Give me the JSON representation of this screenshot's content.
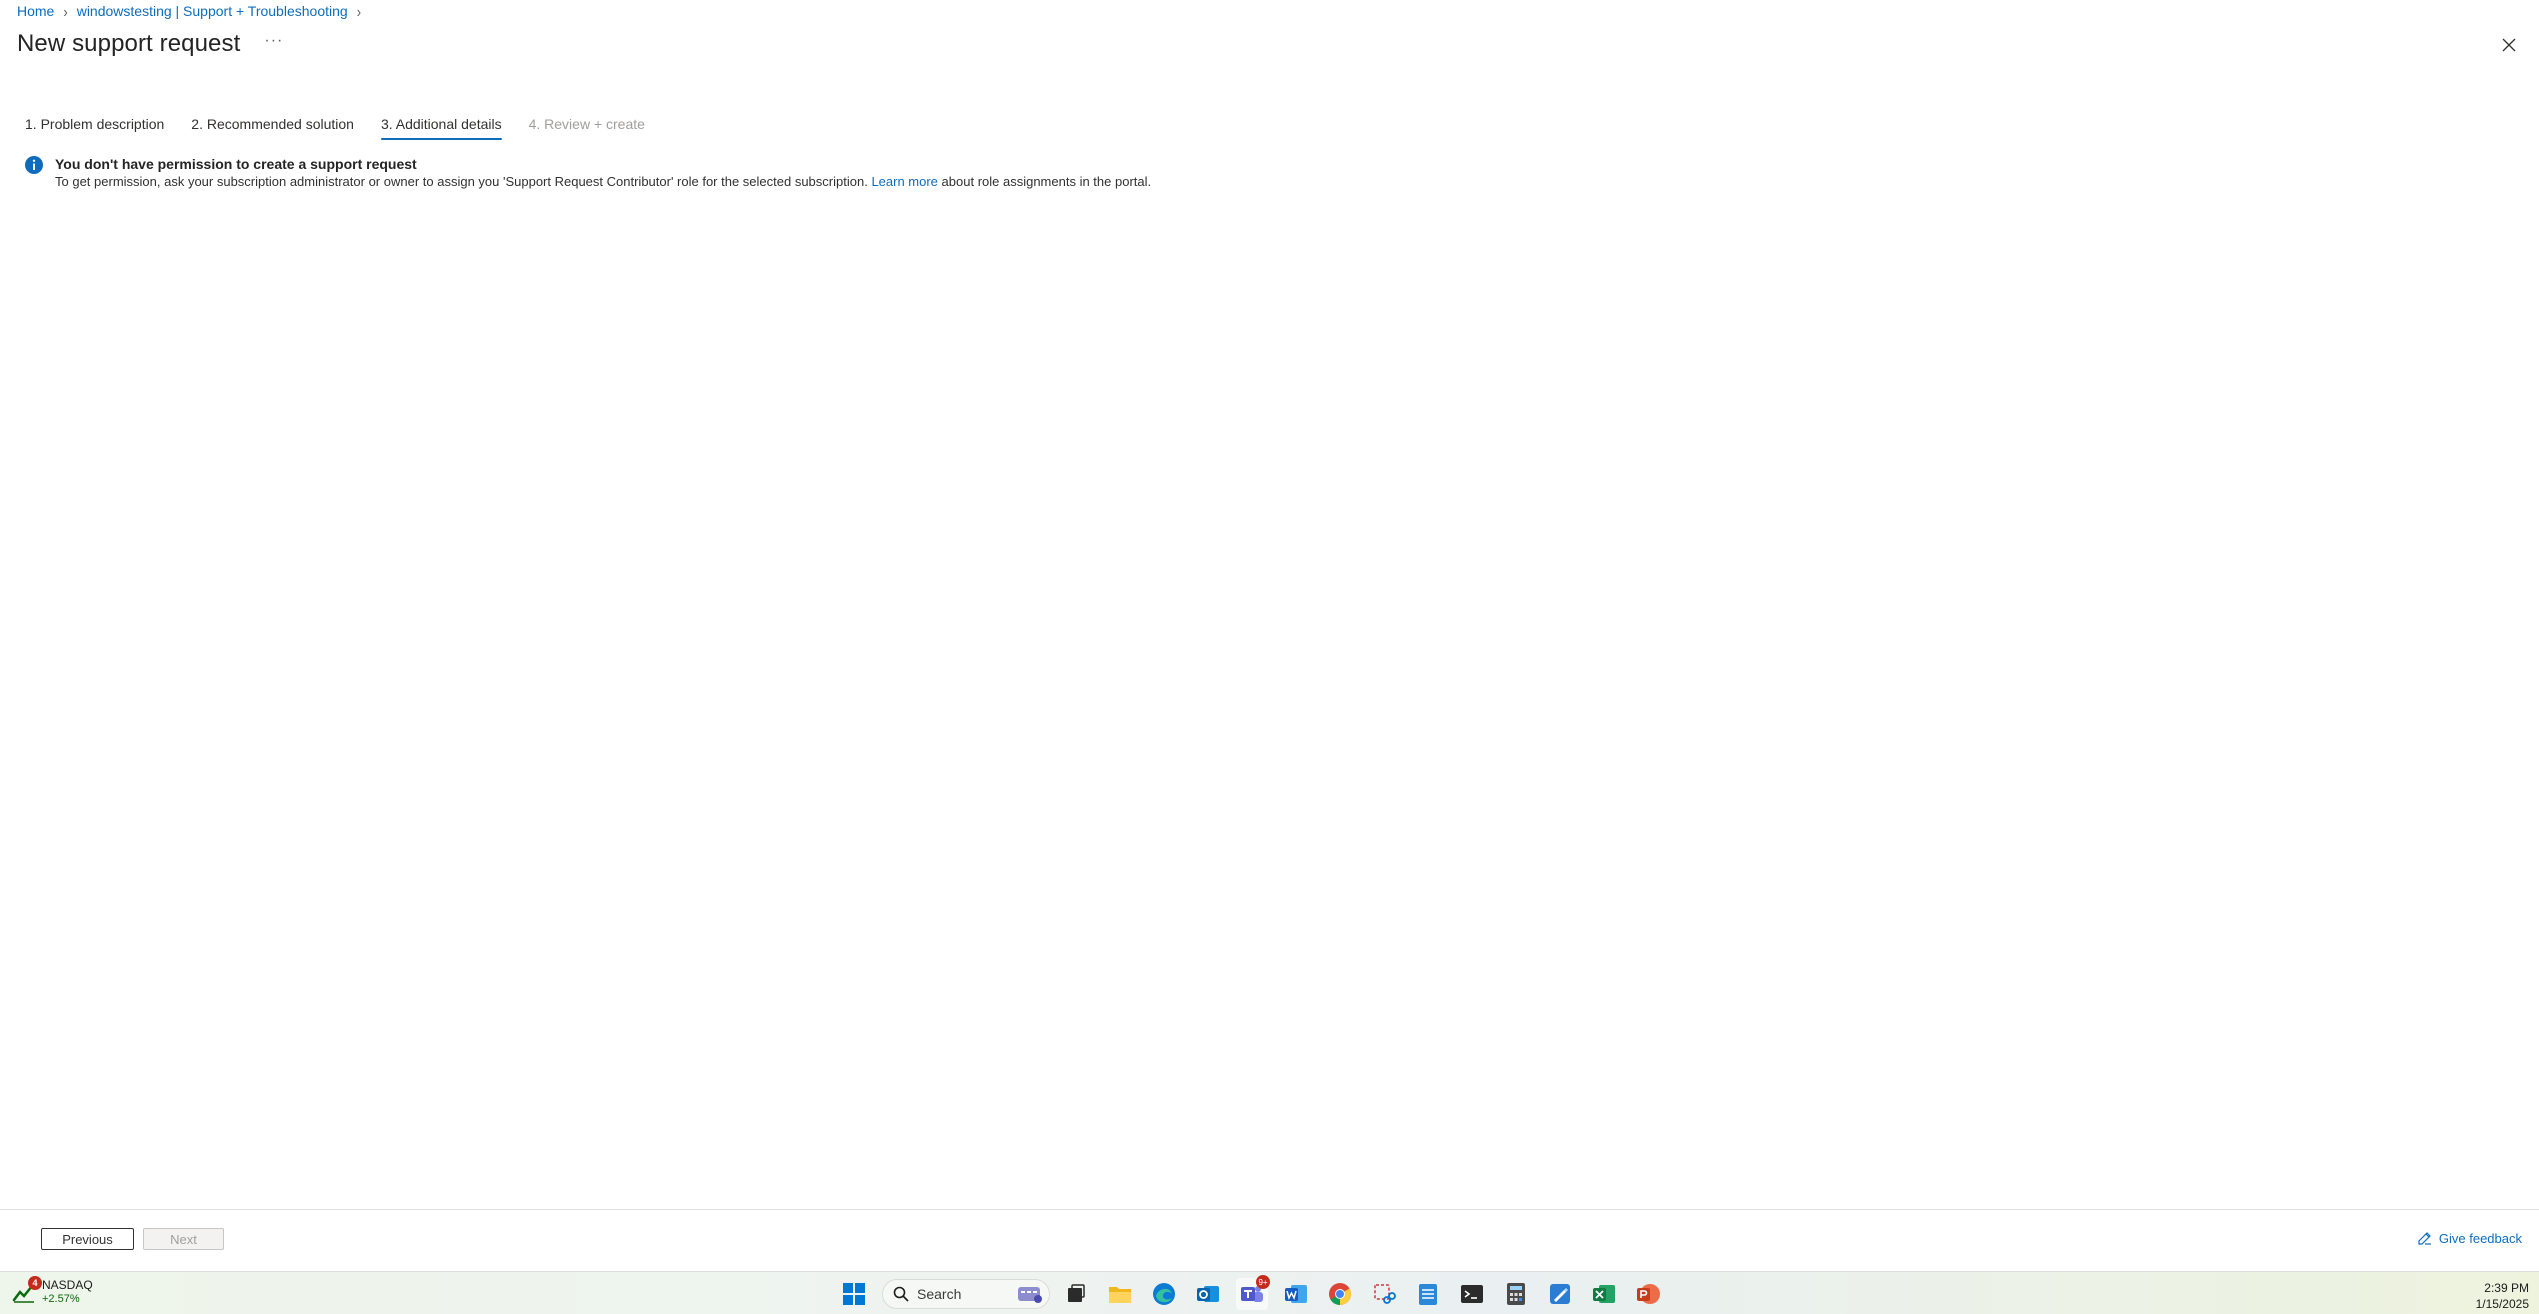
{
  "breadcrumb": {
    "items": [
      "Home",
      "windowstesting | Support + Troubleshooting"
    ]
  },
  "header": {
    "title": "New support request",
    "more": "···"
  },
  "tabs": [
    {
      "label": "1. Problem description",
      "state": "done"
    },
    {
      "label": "2. Recommended solution",
      "state": "done"
    },
    {
      "label": "3. Additional details",
      "state": "active"
    },
    {
      "label": "4. Review + create",
      "state": "disabled"
    }
  ],
  "info": {
    "title": "You don't have permission to create a support request",
    "body_before": "To get permission, ask your subscription administrator or owner to assign you 'Support Request Contributor' role for the selected subscription.",
    "link": "Learn more",
    "body_after": "about role assignments in the portal.",
    "color": "#0f6cbd"
  },
  "footer": {
    "previous": "Previous",
    "next": "Next",
    "feedback": "Give feedback"
  },
  "taskbar": {
    "widget_badge": "4",
    "widget_name": "NASDAQ",
    "widget_value": "+2.57%",
    "search_label": "Search",
    "teams_badge": "9+",
    "apps": [
      "start-icon",
      "search-icon",
      "task-view-icon",
      "file-explorer-icon",
      "edge-icon",
      "outlook-icon",
      "teams-icon",
      "word-icon",
      "chrome-icon",
      "snipping-tool-icon",
      "notepad-icon",
      "terminal-icon",
      "calculator-icon",
      "paint-icon",
      "excel-icon",
      "powerpoint-icon"
    ],
    "time": "2:39 PM",
    "date": "1/15/2025"
  }
}
